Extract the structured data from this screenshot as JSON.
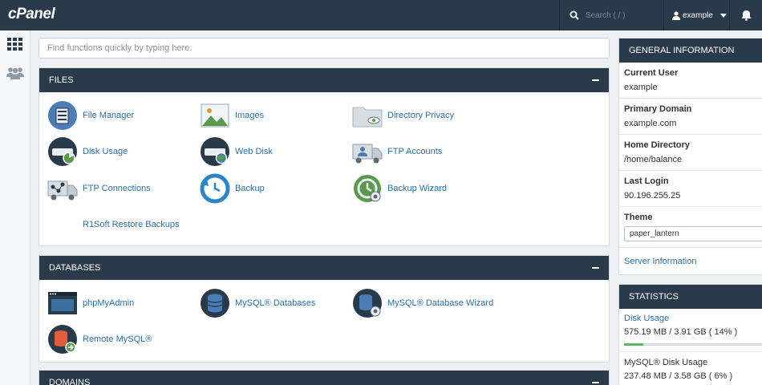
{
  "topbar": {
    "logo": "cPanel",
    "search_placeholder": "Search ( / )",
    "user": "example"
  },
  "find": {
    "placeholder": "Find functions quickly by typing here."
  },
  "panels": {
    "files": {
      "title": "FILES",
      "items": [
        "File Manager",
        "Images",
        "Directory Privacy",
        "Disk Usage",
        "Web Disk",
        "FTP Accounts",
        "FTP Connections",
        "Backup",
        "Backup Wizard",
        "R1Soft Restore Backups"
      ]
    },
    "databases": {
      "title": "DATABASES",
      "items": [
        "phpMyAdmin",
        "MySQL® Databases",
        "MySQL® Database Wizard",
        "Remote MySQL®"
      ]
    },
    "domains": {
      "title": "DOMAINS"
    }
  },
  "general": {
    "title": "GENERAL INFORMATION",
    "current_user_label": "Current User",
    "current_user": "example",
    "primary_domain_label": "Primary Domain",
    "primary_domain": "example.com",
    "home_dir_label": "Home Directory",
    "home_dir": "/home/balance",
    "last_login_label": "Last Login",
    "last_login": "90.196.255.25",
    "theme_label": "Theme",
    "theme": "paper_lantern",
    "server_info": "Server Information"
  },
  "statistics": {
    "title": "STATISTICS",
    "disk_usage_label": "Disk Usage",
    "disk_usage_value": "575.19 MB / 3.91 GB ( 14% )",
    "disk_usage_fraction": 0.14,
    "mysql_label": "MySQL® Disk Usage",
    "mysql_value": "237.48 MB / 3.58 GB ( 6% )"
  },
  "colors": {
    "header": "#293a4a",
    "link": "#2a6fa8",
    "progress": "#5cb85c"
  },
  "icons": [
    "search-icon",
    "user-icon",
    "caret-down-icon",
    "bell-icon",
    "grid-icon",
    "users-icon"
  ]
}
